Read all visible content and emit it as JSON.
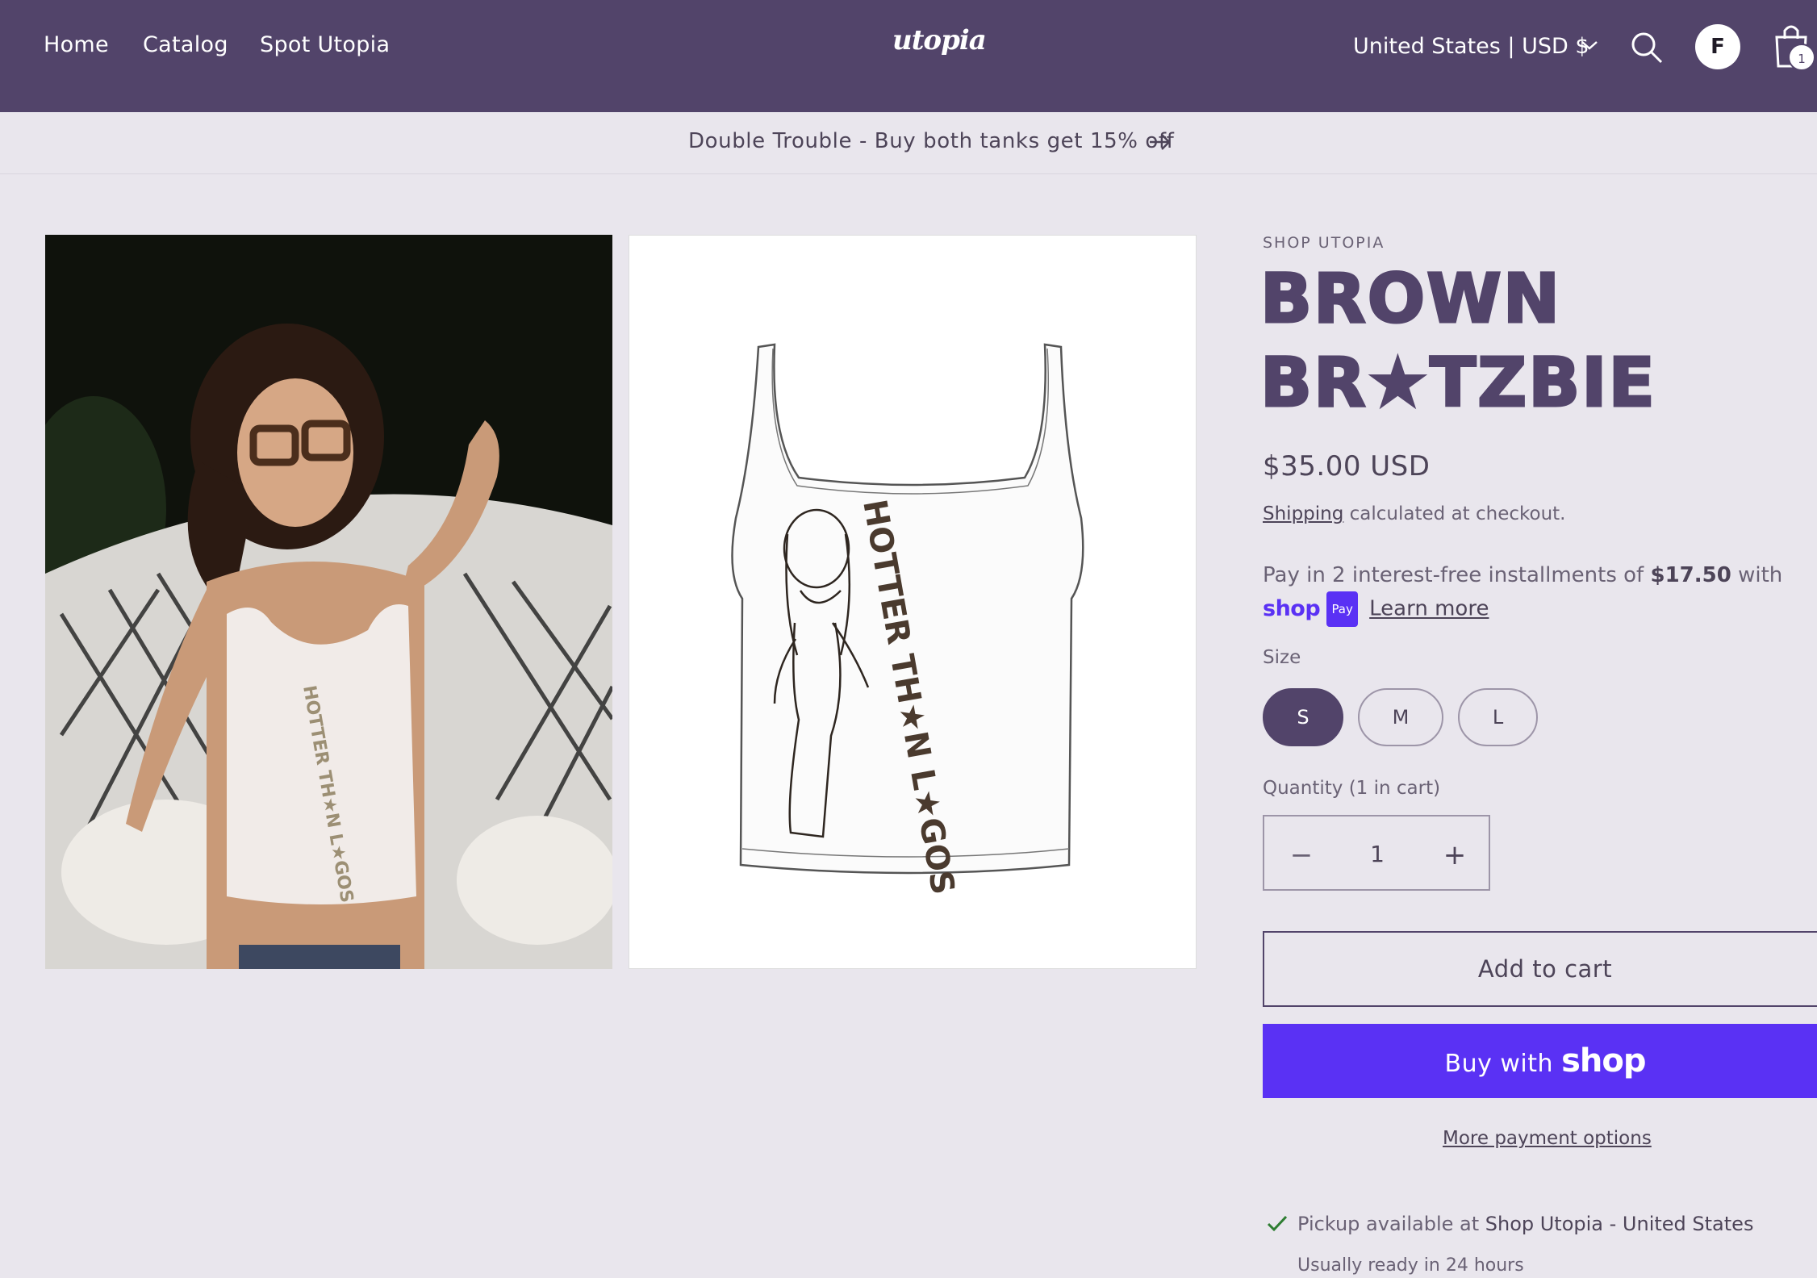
{
  "header": {
    "nav": [
      "Home",
      "Catalog",
      "Spot Utopia"
    ],
    "logo": "utopia",
    "country": "United States | USD $",
    "avatar_initial": "F",
    "cart_count": "1"
  },
  "announcement": {
    "text": "Double Trouble - Buy both tanks get 15% off"
  },
  "gallery": {
    "shirt_text": "HOTTER TH★N L★GOS"
  },
  "product": {
    "vendor": "SHOP UTOPIA",
    "title_line1": "BROWN",
    "title_line2": "BR★TZBIE",
    "price": "$35.00 USD",
    "shipping_link": "Shipping",
    "shipping_rest": " calculated at checkout.",
    "installments_pre": "Pay in 2 interest-free installments of ",
    "installments_amount": "$17.50",
    "installments_post": " with",
    "shoppay_word": "shop",
    "pay_badge": "Pay",
    "learn_more": "Learn more",
    "size_label": "Size",
    "sizes": [
      "S",
      "M",
      "L"
    ],
    "selected_size": "S",
    "quantity_label": "Quantity (1 in cart)",
    "quantity": "1",
    "add_to_cart": "Add to cart",
    "buy_with": "Buy with",
    "buy_shop_word": "shop",
    "more_payment": "More payment options",
    "pickup_pre": "Pickup available at ",
    "pickup_location": "Shop Utopia - United States",
    "ready_text": "Usually ready in 24 hours"
  },
  "colors": {
    "header_bg": "#52446a",
    "page_bg": "#e9e6ed",
    "shop_pay": "#5a31f4",
    "check": "#2e7d32"
  }
}
